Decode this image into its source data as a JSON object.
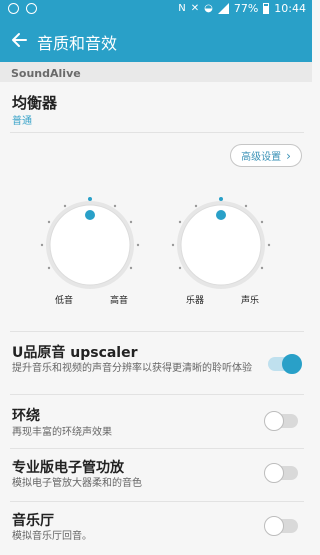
{
  "status_bar": {
    "battery": "77%",
    "time": "10:44"
  },
  "header": {
    "title": "音质和音效"
  },
  "section": {
    "title": "SoundAlive"
  },
  "equalizer": {
    "title": "均衡器",
    "value": "普通",
    "advanced_label": "高级设置"
  },
  "dials": {
    "left": {
      "label_left": "低音",
      "label_right": "高音"
    },
    "right": {
      "label_left": "乐器",
      "label_right": "声乐"
    }
  },
  "settings": [
    {
      "title": "U品原音 upscaler",
      "desc": "提升音乐和视频的声音分辨率以获得更清晰的聆听体验",
      "enabled": true
    },
    {
      "title": "环绕",
      "desc": "再现丰富的环绕声效果",
      "enabled": false
    },
    {
      "title": "专业版电子管功放",
      "desc": "模拟电子管放大器柔和的音色",
      "enabled": false
    },
    {
      "title": "音乐厅",
      "desc": "模拟音乐厅回音。",
      "enabled": false
    }
  ],
  "colors": {
    "accent": "#29a0c8"
  },
  "icons": {
    "back": "arrow-left-icon",
    "chevron": "chevron-right-icon"
  }
}
